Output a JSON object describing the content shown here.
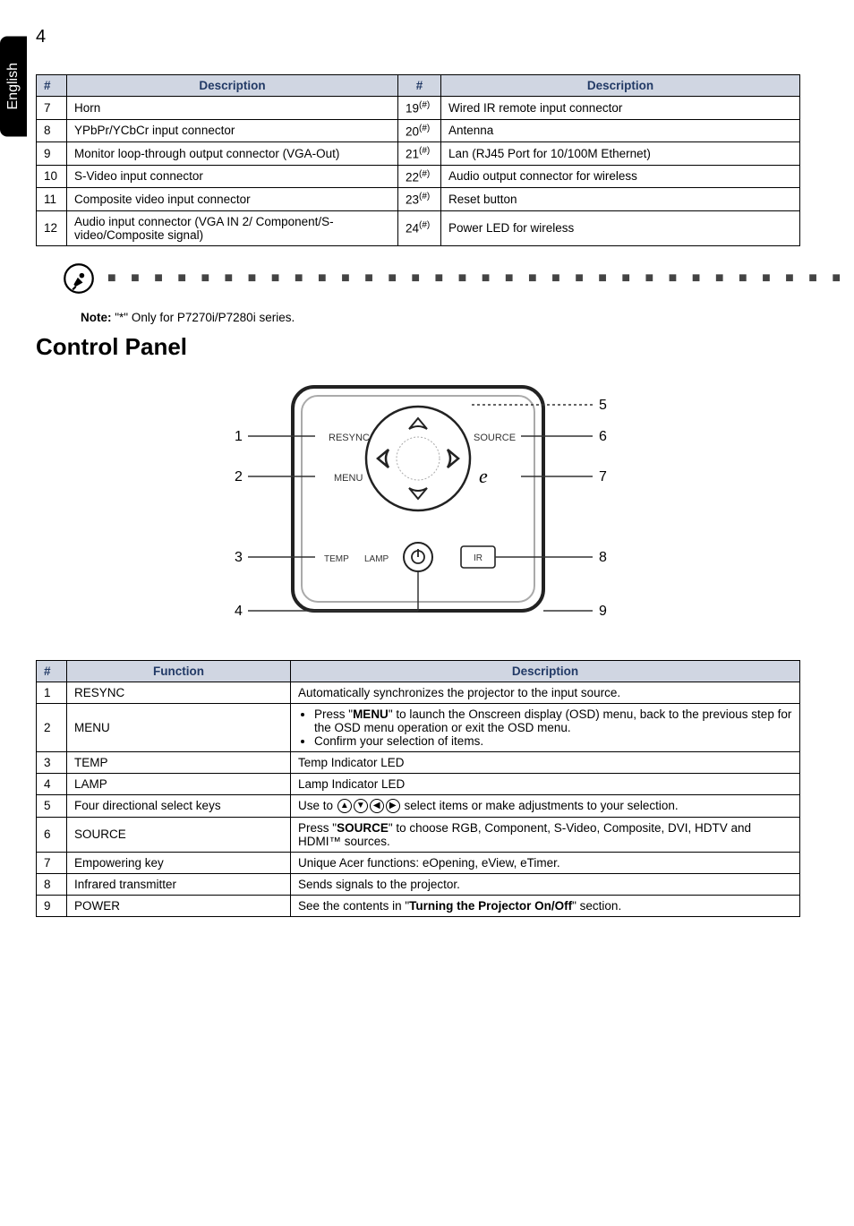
{
  "pageNumber": "4",
  "sideTab": "English",
  "table1": {
    "headers": [
      "#",
      "Description",
      "#",
      "Description"
    ],
    "rows": [
      {
        "n1": "7",
        "d1": "Horn",
        "n2": "19",
        "d2": "Wired IR remote input connector"
      },
      {
        "n1": "8",
        "d1": "YPbPr/YCbCr input connector",
        "n2": "20",
        "d2": "Antenna"
      },
      {
        "n1": "9",
        "d1": "Monitor loop-through output connector (VGA-Out)",
        "n2": "21",
        "d2": "Lan (RJ45 Port for 10/100M Ethernet)"
      },
      {
        "n1": "10",
        "d1": "S-Video input connector",
        "n2": "22",
        "d2": "Audio output connector for wireless"
      },
      {
        "n1": "11",
        "d1": "Composite video input connector",
        "n2": "23",
        "d2": "Reset button"
      },
      {
        "n1": "12",
        "d1": "Audio input connector (VGA IN 2/ Component/S-video/Composite signal)",
        "n2": "24",
        "d2": "Power LED for wireless"
      }
    ],
    "sup": "(#)"
  },
  "note": {
    "label": "Note:",
    "text": "\"*\" Only for P7270i/P7280i series."
  },
  "controlPanelTitle": "Control Panel",
  "diagram": {
    "labels": {
      "l1": "1",
      "l2": "2",
      "l3": "3",
      "l4": "4",
      "r5": "5",
      "r6": "6",
      "r7": "7",
      "r8": "8",
      "r9": "9",
      "resync": "RESYNC",
      "source": "SOURCE",
      "menu": "MENU",
      "temp": "TEMP",
      "lamp": "LAMP",
      "ir": "IR",
      "e": "e"
    }
  },
  "table2": {
    "headers": [
      "#",
      "Function",
      "Description"
    ],
    "rows": [
      {
        "n": "1",
        "f": "RESYNC",
        "d": "Automatically synchronizes the projector to the input source."
      },
      {
        "n": "2",
        "f": "MENU",
        "bullets": [
          {
            "pre": "Press \"",
            "bold": "MENU",
            "post": "\" to launch the Onscreen display (OSD) menu, back to the previous step for the OSD menu operation or exit the OSD menu."
          },
          {
            "plain": "Confirm your selection of items."
          }
        ]
      },
      {
        "n": "3",
        "f": "TEMP",
        "d": "Temp Indicator LED"
      },
      {
        "n": "4",
        "f": "LAMP",
        "d": "Lamp Indicator LED"
      },
      {
        "n": "5",
        "f": "Four directional select keys",
        "arrowPre": "Use to ",
        "arrowPost": " select items or make adjustments to your selection."
      },
      {
        "n": "6",
        "f": "SOURCE",
        "pre": "Press \"",
        "bold": "SOURCE",
        "post": "\" to choose RGB, Component, S-Video, Composite, DVI, HDTV and HDMI™ sources."
      },
      {
        "n": "7",
        "f": "Empowering key",
        "d": "Unique Acer functions: eOpening, eView, eTimer."
      },
      {
        "n": "8",
        "f": "Infrared transmitter",
        "d": "Sends signals to the projector."
      },
      {
        "n": "9",
        "f": "POWER",
        "pre": "See the contents in \"",
        "bold": "Turning the Projector On/Off",
        "post": "\" section."
      }
    ]
  }
}
